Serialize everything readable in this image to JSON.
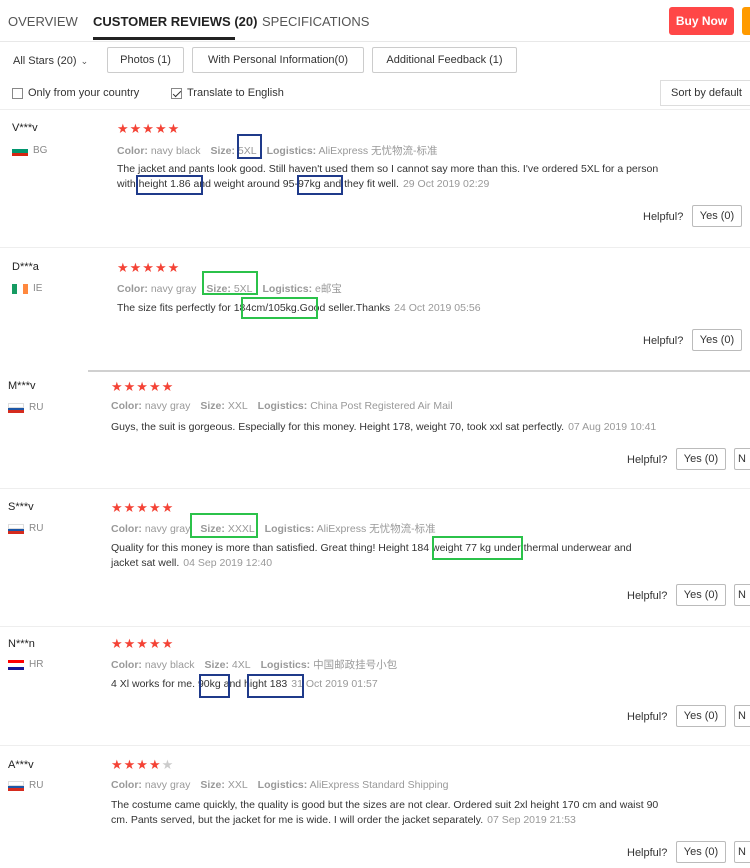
{
  "tabs": [
    {
      "label": "OVERVIEW"
    },
    {
      "label": "CUSTOMER REVIEWS (20)"
    },
    {
      "label": "SPECIFICATIONS"
    }
  ],
  "buy_now": "Buy Now",
  "filters": {
    "stars": "All Stars (20)",
    "photos": "Photos (1)",
    "personal": "With Personal Information(0)",
    "additional": "Additional Feedback (1)",
    "own_country": "Only from your country",
    "translate": "Translate to English",
    "sort": "Sort by default"
  },
  "labels": {
    "color": "Color:",
    "size": "Size:",
    "logistics": "Logistics:",
    "helpful": "Helpful?"
  },
  "reviews": [
    {
      "user": "V***v",
      "country": "BG",
      "stars": 5,
      "color": "navy black",
      "size": "5XL",
      "logistics": "AliExpress 无忧物流-标准",
      "text_line1": "The jacket and pants look good. Still haven't used them so I cannot say more than this. I've ordered 5XL for a person",
      "text_line2": "with height 1.86 and weight around 95-97kg and they fit well.",
      "date": "29 Oct 2019 02:29",
      "yes": "Yes (0)"
    },
    {
      "user": "D***a",
      "country": "IE",
      "stars": 5,
      "color": "navy gray",
      "size": "5XL",
      "logistics": "e邮宝",
      "text_line1": "The size fits perfectly for 184cm/105kg.Good seller.Thanks",
      "date": "24 Oct 2019 05:56",
      "yes": "Yes (0)"
    },
    {
      "user": "M***v",
      "country": "RU",
      "stars": 5,
      "color": "navy gray",
      "size": "XXL",
      "logistics": "China Post Registered Air Mail",
      "text_line1": "Guys, the suit is gorgeous. Especially for this money. Height 178, weight 70, took xxl sat perfectly.",
      "date": "07 Aug 2019 10:41",
      "yes": "Yes (0)",
      "no": "N"
    },
    {
      "user": "S***v",
      "country": "RU",
      "stars": 5,
      "color": "navy gray",
      "size": "XXXL",
      "logistics": "AliExpress 无忧物流-标准",
      "text_line1": "Quality for this money is more than satisfied. Great thing! Height 184 weight 77 kg under thermal underwear and",
      "text_line2": "jacket sat well.",
      "date": "04 Sep 2019 12:40",
      "yes": "Yes (0)",
      "no": "N"
    },
    {
      "user": "N***n",
      "country": "HR",
      "stars": 5,
      "color": "navy black",
      "size": "4XL",
      "logistics": "中国邮政挂号小包",
      "text_line1": "4 Xl works for me. 90kg and hight 183",
      "date": "31 Oct 2019 01:57",
      "yes": "Yes (0)",
      "no": "N"
    },
    {
      "user": "A***v",
      "country": "RU",
      "stars": 4,
      "color": "navy gray",
      "size": "XXL",
      "logistics": "AliExpress Standard Shipping",
      "text_line1": "The costume came quickly, the quality is good but the sizes are not clear. Ordered suit 2xl height 170 cm and waist 90",
      "text_line2": "cm. Pants served, but the jacket for me is wide. I will order the jacket separately.",
      "date": "07 Sep 2019 21:53",
      "yes": "Yes (0)",
      "no": "N"
    }
  ],
  "colors": {
    "star": "#f44336",
    "buy": "#ff4747",
    "highlight_blue": "#1f3a8a",
    "highlight_green": "#2bc24a"
  }
}
